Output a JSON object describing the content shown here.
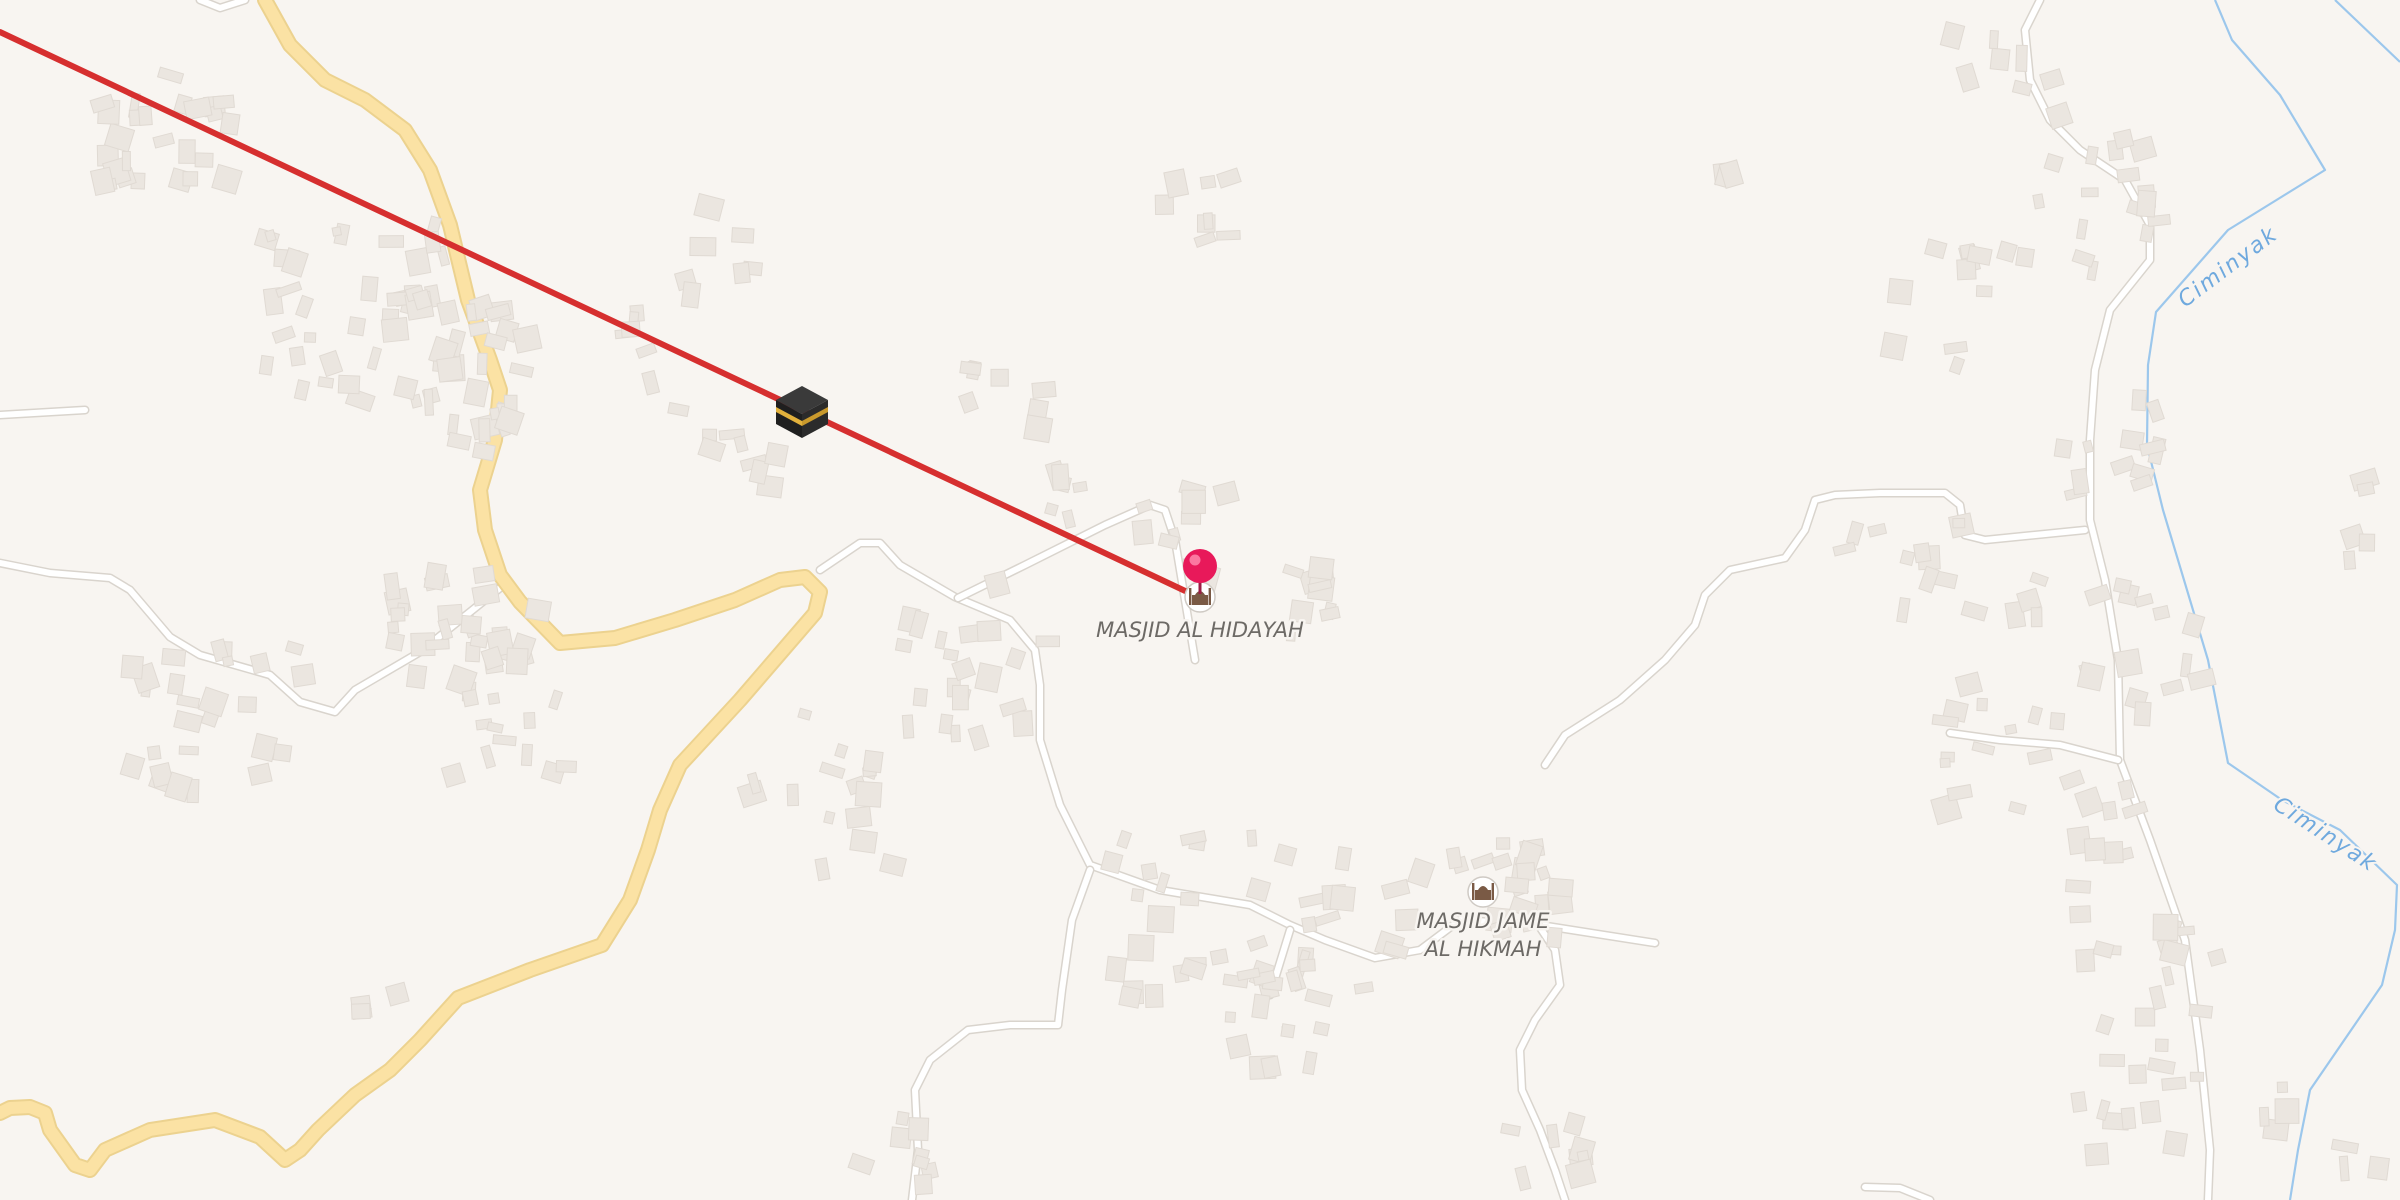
{
  "map": {
    "pois": [
      {
        "id": "masjid-al-hidayah",
        "icon": "mosque-icon",
        "label": "MASJID AL HIDAYAH"
      },
      {
        "id": "masjid-jame-al-hikmah",
        "icon": "mosque-icon",
        "label_line1": "MASJID JAME",
        "label_line2": "AL HIKMAH"
      }
    ],
    "rivers": [
      {
        "label": "Ciminyak"
      },
      {
        "label": "Ciminyak"
      }
    ],
    "qibla_line": {
      "color": "#d62f2f",
      "icon": "kaaba-icon"
    },
    "marker": {
      "icon": "location-pin-icon",
      "color": "#e8195a"
    },
    "colors": {
      "background": "#f8f5f1",
      "minor_road": "#ffffff",
      "major_road": "#fbe2a4",
      "building": "#ebe6e0",
      "river": "#9cc7ec"
    }
  }
}
